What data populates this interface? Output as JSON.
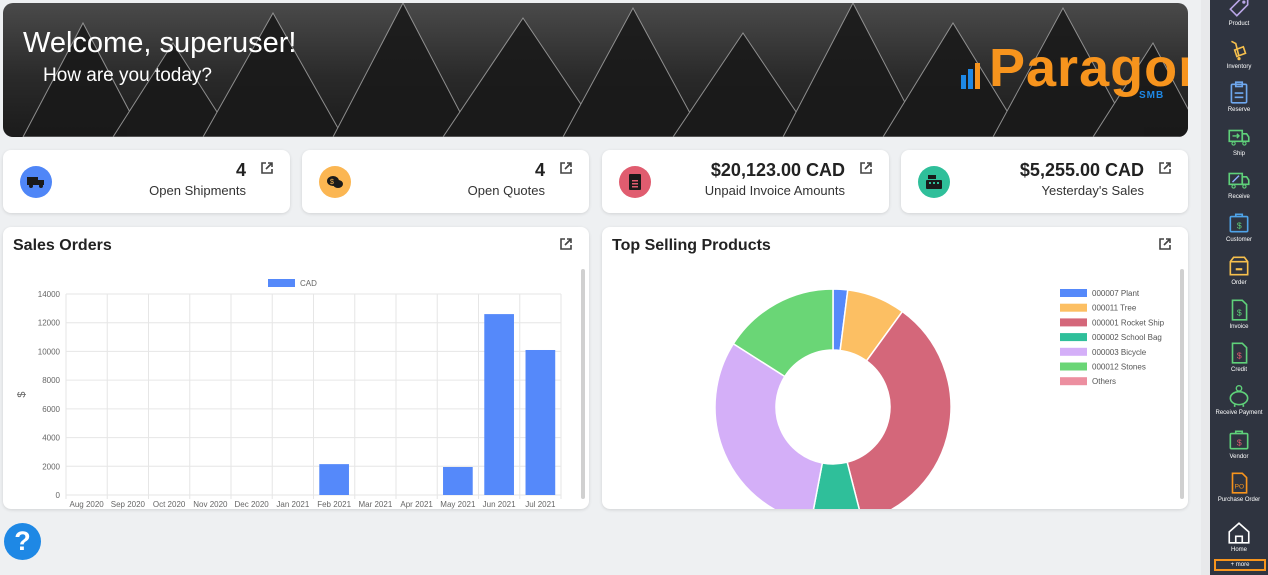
{
  "hero": {
    "title": "Welcome, superuser!",
    "subtitle": "How are you today?",
    "logo_text": "Paragon",
    "logo_sub": "SMB"
  },
  "stats": [
    {
      "value": "4",
      "label": "Open Shipments",
      "icon": "truck-icon",
      "color": "#4f86f7"
    },
    {
      "value": "4",
      "label": "Open Quotes",
      "icon": "quote-icon",
      "color": "#fbb652"
    },
    {
      "value": "$20,123.00 CAD",
      "label": "Unpaid Invoice Amounts",
      "icon": "invoice-icon",
      "color": "#e05c6f"
    },
    {
      "value": "$5,255.00 CAD",
      "label": "Yesterday's Sales",
      "icon": "cash-register-icon",
      "color": "#2fbf9a"
    }
  ],
  "sales_orders": {
    "title": "Sales Orders"
  },
  "top_products": {
    "title": "Top Selling Products"
  },
  "chart_data": [
    {
      "type": "bar",
      "categories": [
        "Aug 2020",
        "Sep 2020",
        "Oct 2020",
        "Nov 2020",
        "Dec 2020",
        "Jan 2021",
        "Feb 2021",
        "Mar 2021",
        "Apr 2021",
        "May 2021",
        "Jun 2021",
        "Jul 2021"
      ],
      "series": [
        {
          "name": "CAD",
          "values": [
            0,
            0,
            0,
            0,
            0,
            0,
            2150,
            0,
            0,
            1950,
            12600,
            10100
          ],
          "color": "#5589fa"
        }
      ],
      "ylabel": "$",
      "ylim": [
        0,
        14000
      ],
      "yticks": [
        0,
        2000,
        4000,
        6000,
        8000,
        10000,
        12000,
        14000
      ],
      "grid": true,
      "legend": "top"
    },
    {
      "type": "pie",
      "variant": "doughnut",
      "labels": [
        "000007 Plant",
        "000011 Tree",
        "000001 Rocket Ship",
        "000002 School Bag",
        "000003 Bicycle",
        "000012 Stones",
        "Others"
      ],
      "values": [
        2,
        8,
        36,
        7,
        31,
        16,
        0
      ],
      "colors": [
        "#5589fa",
        "#fcbf63",
        "#d4677a",
        "#2fbf9a",
        "#d4aff8",
        "#6ad676",
        "#ec8fa0"
      ],
      "legend": "right"
    }
  ],
  "sidebar": {
    "items": [
      {
        "label": "Product",
        "icon": "product-tag-icon"
      },
      {
        "label": "Inventory",
        "icon": "inventory-icon"
      },
      {
        "label": "Reserve",
        "icon": "reserve-clipboard-icon"
      },
      {
        "label": "Ship",
        "icon": "ship-truck-icon"
      },
      {
        "label": "Receive",
        "icon": "receive-truck-icon"
      },
      {
        "label": "Customer",
        "icon": "customer-icon"
      },
      {
        "label": "Order",
        "icon": "order-icon"
      },
      {
        "label": "Invoice",
        "icon": "invoice-doc-icon"
      },
      {
        "label": "Credit",
        "icon": "credit-doc-icon"
      },
      {
        "label": "Receive Payment",
        "icon": "piggy-bank-icon"
      },
      {
        "label": "Vendor",
        "icon": "vendor-icon"
      },
      {
        "label": "Purchase Order",
        "icon": "purchase-order-icon"
      },
      {
        "label": "Home",
        "icon": "home-icon"
      }
    ],
    "more_label": "+ more"
  },
  "help": {
    "label": "?"
  }
}
